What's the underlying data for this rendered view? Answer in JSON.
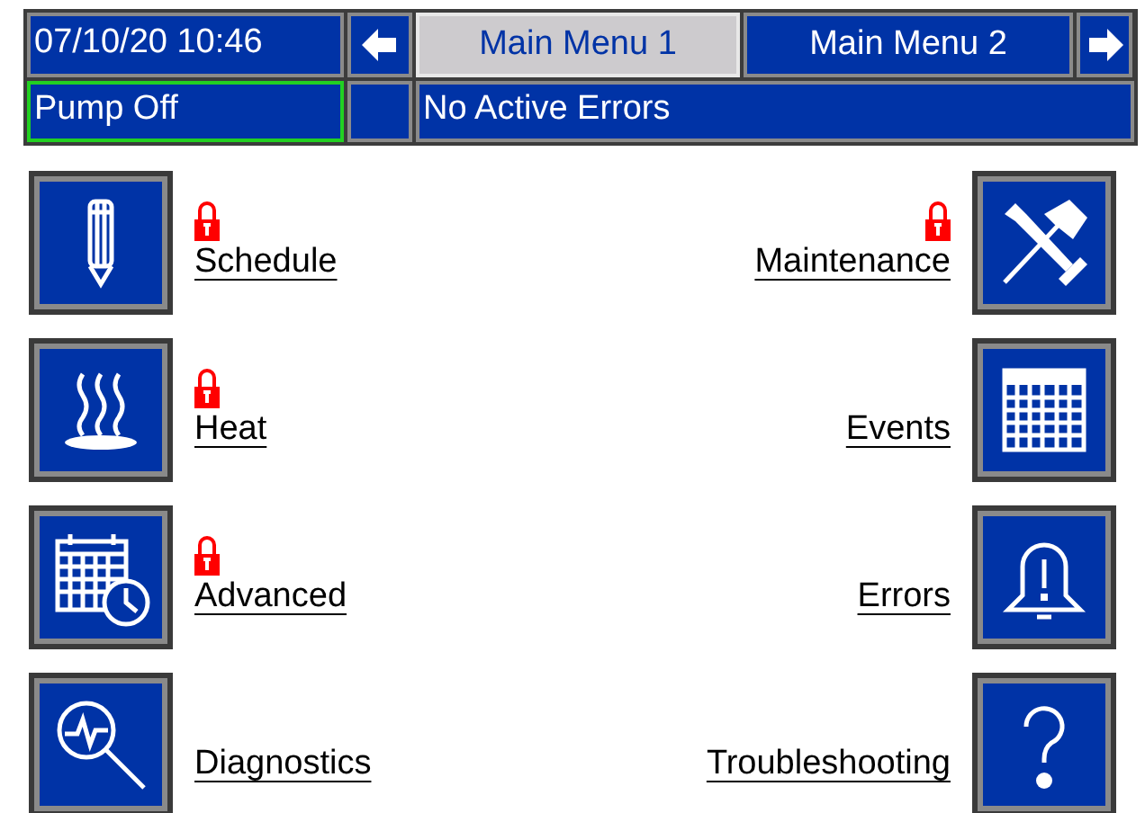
{
  "status_bar": {
    "datetime": "07/10/20 10:46",
    "tabs": [
      {
        "label": "Main Menu 1",
        "selected": true
      },
      {
        "label": "Main Menu 2",
        "selected": false
      }
    ],
    "pump_status": "Pump Off",
    "pump_active": false,
    "errors": "No Active Errors"
  },
  "left_items": [
    {
      "label": "Schedule",
      "locked": true,
      "kind": "pencil"
    },
    {
      "label": "Heat",
      "locked": true,
      "kind": "heat"
    },
    {
      "label": "Advanced",
      "locked": true,
      "kind": "calendar-clock"
    },
    {
      "label": "Diagnostics",
      "locked": false,
      "kind": "magnifier"
    }
  ],
  "right_items": [
    {
      "label": "Maintenance",
      "locked": true,
      "kind": "tools"
    },
    {
      "label": "Events",
      "locked": false,
      "kind": "calendar"
    },
    {
      "label": "Errors",
      "locked": false,
      "kind": "bell"
    },
    {
      "label": "Troubleshooting",
      "locked": false,
      "kind": "question"
    }
  ]
}
